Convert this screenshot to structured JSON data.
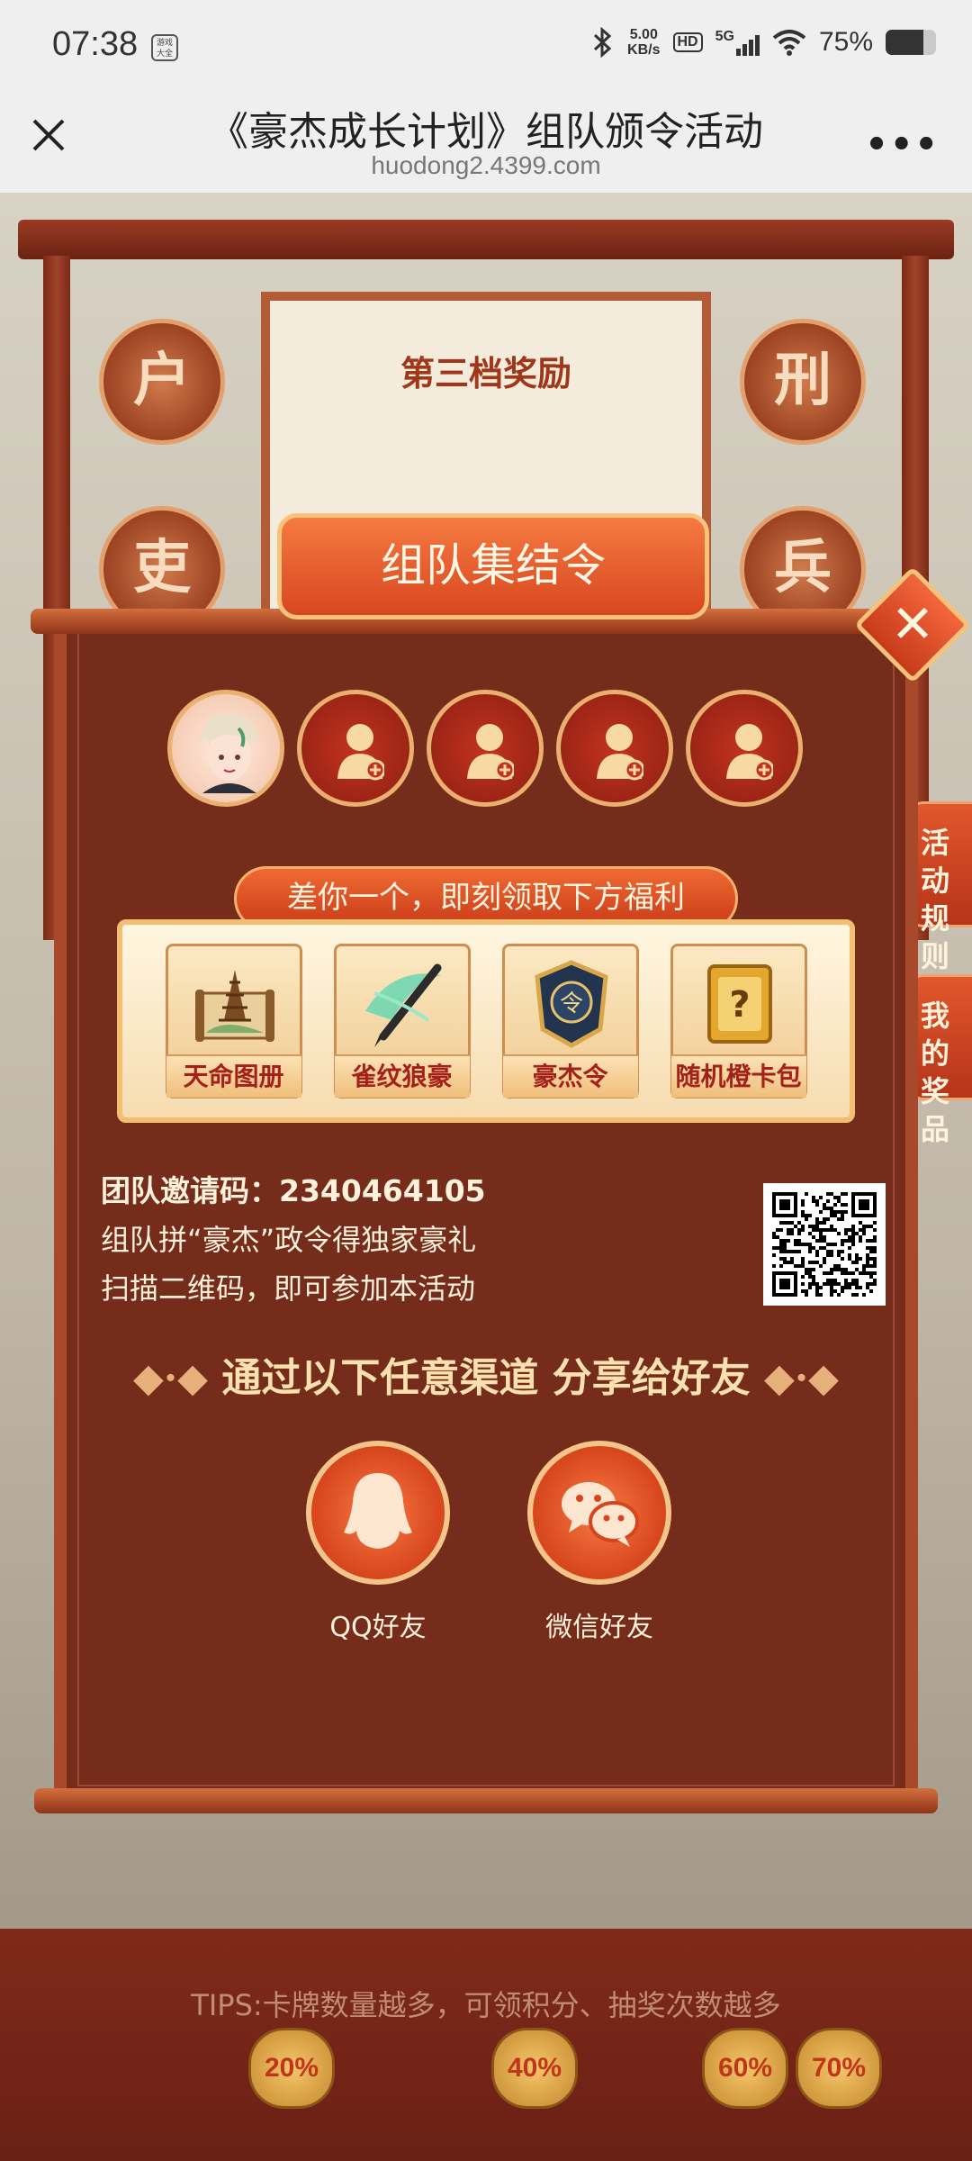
{
  "status_bar": {
    "time": "07:38",
    "app_icon_text": "游戏大全",
    "net_speed_value": "5.00",
    "net_speed_unit": "KB/s",
    "hd_label": "HD",
    "network_label": "5G",
    "battery_text": "75%",
    "battery_level": 0.75
  },
  "browser": {
    "title": "《豪杰成长计划》组队颁令活动",
    "url": "huodong2.4399.com",
    "more_label": "•••"
  },
  "background": {
    "scroll_title": "第三档奖励",
    "medals": [
      "户",
      "刑",
      "吏",
      "兵"
    ],
    "side_tabs": [
      "活动规则",
      "我的奖品"
    ],
    "tips": "TIPS:卡牌数量越多，可领积分、抽奖次数越多",
    "lanterns": [
      "20%",
      "40%",
      "60%",
      "70%"
    ]
  },
  "modal": {
    "title": "组队集结令",
    "close_label": "✕",
    "members_total": 5,
    "members_filled": 1,
    "ribbon": "差你一个，即刻领取下方福利",
    "rewards": [
      {
        "label": "天命图册",
        "icon": "scroll-map-icon"
      },
      {
        "label": "雀纹狼豪",
        "icon": "brush-icon"
      },
      {
        "label": "豪杰令",
        "icon": "token-icon"
      },
      {
        "label": "随机橙卡包",
        "icon": "mystery-card-icon"
      }
    ],
    "invite_label": "团队邀请码：",
    "invite_code": "2340464105",
    "invite_line2": "组队拼“豪杰”政令得独家豪礼",
    "invite_line3": "扫描二维码，即可参加本活动",
    "share_title": "通过以下任意渠道 分享给好友",
    "share_options": [
      {
        "label": "QQ好友",
        "icon": "qq-penguin-icon"
      },
      {
        "label": "微信好友",
        "icon": "wechat-icon"
      }
    ]
  },
  "colors": {
    "modal_bg": "#752c1a",
    "accent": "#d8471f",
    "gold": "#f2bf72"
  }
}
